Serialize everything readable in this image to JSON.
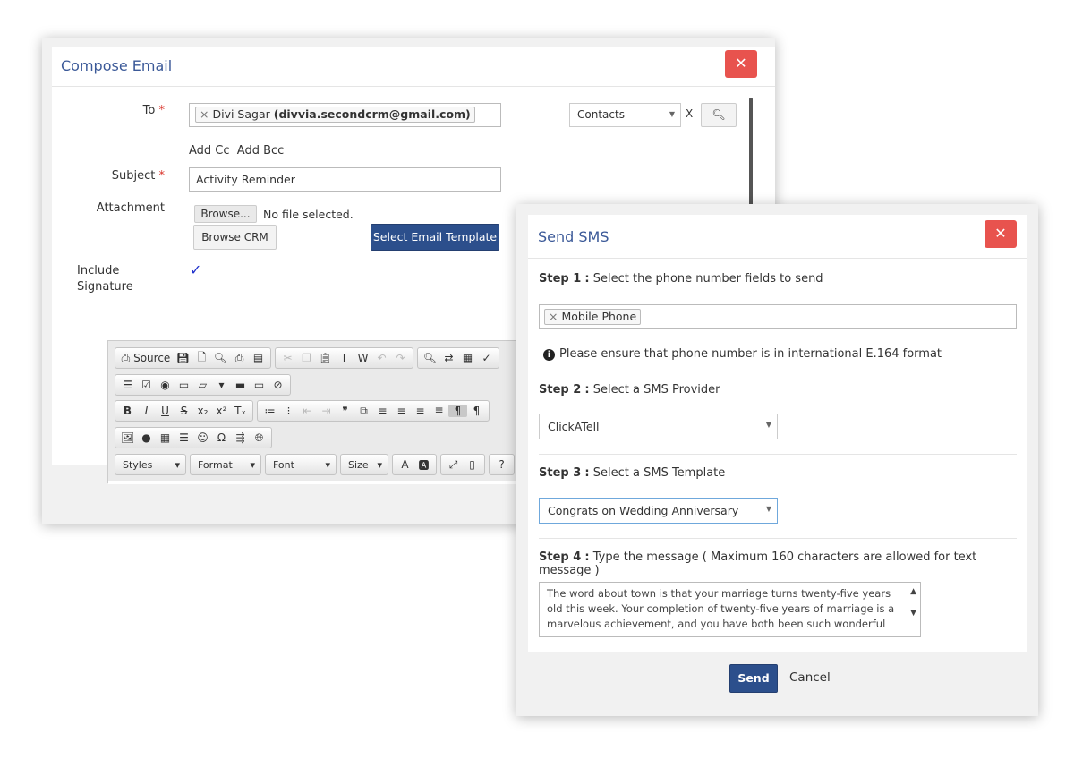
{
  "compose": {
    "title": "Compose Email",
    "close": "✕",
    "to_label": "To",
    "required": "*",
    "to_name": "Divi Sagar",
    "to_email": "(divvia.secondcrm@gmail.com)",
    "tag_remove": "×",
    "module_select": "Contacts",
    "clear": "X",
    "add_cc": "Add Cc",
    "add_bcc": "Add Bcc",
    "subject_label": "Subject",
    "subject_value": "Activity Reminder",
    "attachment_label": "Attachment",
    "browse": "Browse...",
    "no_file": "No file selected.",
    "browse_crm": "Browse CRM",
    "select_template": "Select Email Template",
    "include_signature_label": "Include Signature",
    "signature_checked": true,
    "toolbar": {
      "row1": [
        [
          "source",
          "save",
          "new-page",
          "preview",
          "print",
          "templates"
        ],
        [
          "cut",
          "copy",
          "paste",
          "paste-text",
          "paste-word",
          "undo",
          "redo"
        ],
        [
          "find",
          "replace",
          "select-all",
          "spellcheck"
        ]
      ],
      "row2": [
        [
          "form",
          "checkbox",
          "radio",
          "text-field",
          "textarea",
          "select",
          "button",
          "image-button",
          "hidden-field"
        ]
      ],
      "row3": [
        [
          "bold",
          "italic",
          "underline",
          "strike",
          "subscript",
          "superscript",
          "remove-format"
        ],
        [
          "numbered-list",
          "bulleted-list",
          "outdent",
          "indent",
          "blockquote",
          "div",
          "align-left",
          "align-center",
          "align-right",
          "justify",
          "ltr",
          "rtl"
        ]
      ],
      "row4": [
        [
          "image",
          "flash",
          "table",
          "horizontal-rule",
          "smiley",
          "special-char",
          "page-break",
          "iframe"
        ]
      ],
      "source_label": "Source",
      "combos": [
        "Styles",
        "Format",
        "Font",
        "Size"
      ],
      "row5_icons": [
        "text-color",
        "bg-color",
        "maximize",
        "show-blocks",
        "help"
      ]
    }
  },
  "sms": {
    "title": "Send SMS",
    "close": "✕",
    "sep": ":",
    "step1_label": "Step 1",
    "step1_text": "Select the phone number fields to send",
    "phone_field": "Mobile Phone",
    "tag_remove": "×",
    "info": "Please ensure that phone number is in international E.164 format",
    "step2_label": "Step 2",
    "step2_text": "Select a SMS Provider",
    "provider": "ClickATell",
    "step3_label": "Step 3",
    "step3_text": "Select a SMS Template",
    "template": "Congrats on Wedding Anniversary",
    "step4_label": "Step 4",
    "step4_text": "Type the message ( Maximum 160 characters are allowed for text message )",
    "message": "The word about town is that your marriage turns twenty-five years old this week. Your completion of twenty-five years of marriage is a marvelous achievement, and you have both been such wonderful",
    "send": "Send",
    "cancel": "Cancel"
  },
  "colors": {
    "accent": "#2c4f8c",
    "close": "#e8534e",
    "title": "#3b5998"
  }
}
